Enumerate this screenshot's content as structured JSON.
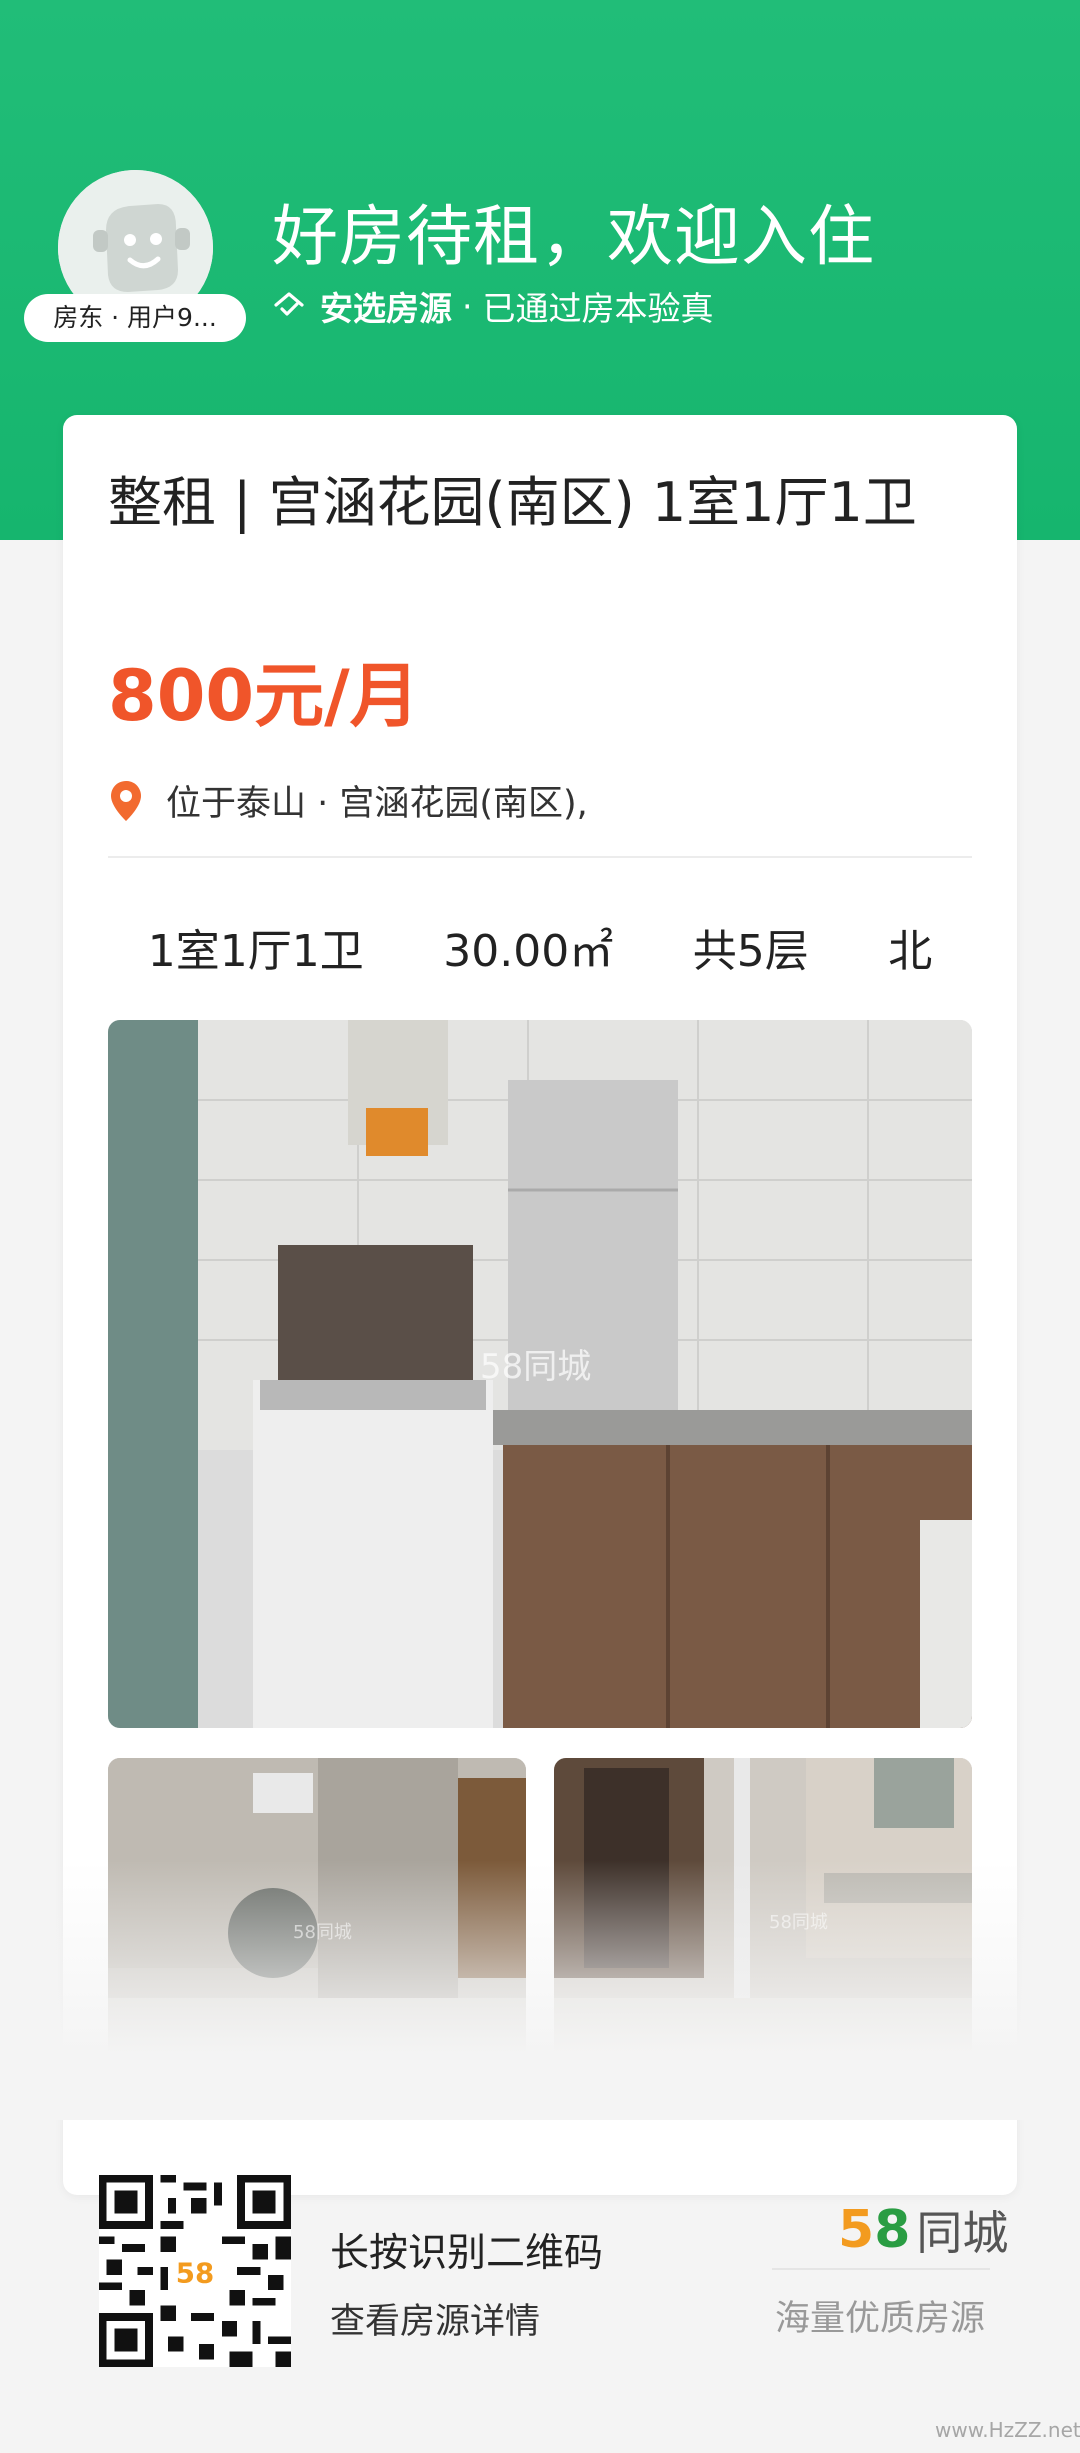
{
  "hero": {
    "owner_tag": "房东 · 用户9...",
    "title": "好房待租，欢迎入住",
    "sub_strong": "安选房源",
    "sub_dot": "·",
    "sub_rest": "已通过房本验真",
    "icon": "house-check-icon"
  },
  "listing": {
    "title": "整租 | 宫涵花园(南区) 1室1厅1卫",
    "price": "800元/月",
    "location": "位于泰山 · 宫涵花园(南区),",
    "location_icon": "location-pin-icon",
    "facts": {
      "layout": "1室1厅1卫",
      "area": "30.00㎡",
      "floors": "共5层",
      "orientation": "北"
    },
    "photo_watermark": "58同城"
  },
  "footer": {
    "qr_line1": "长按识别二维码",
    "qr_line2": "查看房源详情",
    "brand_5": "5",
    "brand_8": "8",
    "brand_text": "同城",
    "slogan": "海量优质房源",
    "qr_center": "58"
  },
  "watermark": "www.HzZZ.net",
  "colors": {
    "hero_green": "#1db872",
    "price_orange": "#f0552a",
    "pin_orange": "#f26a2f"
  }
}
